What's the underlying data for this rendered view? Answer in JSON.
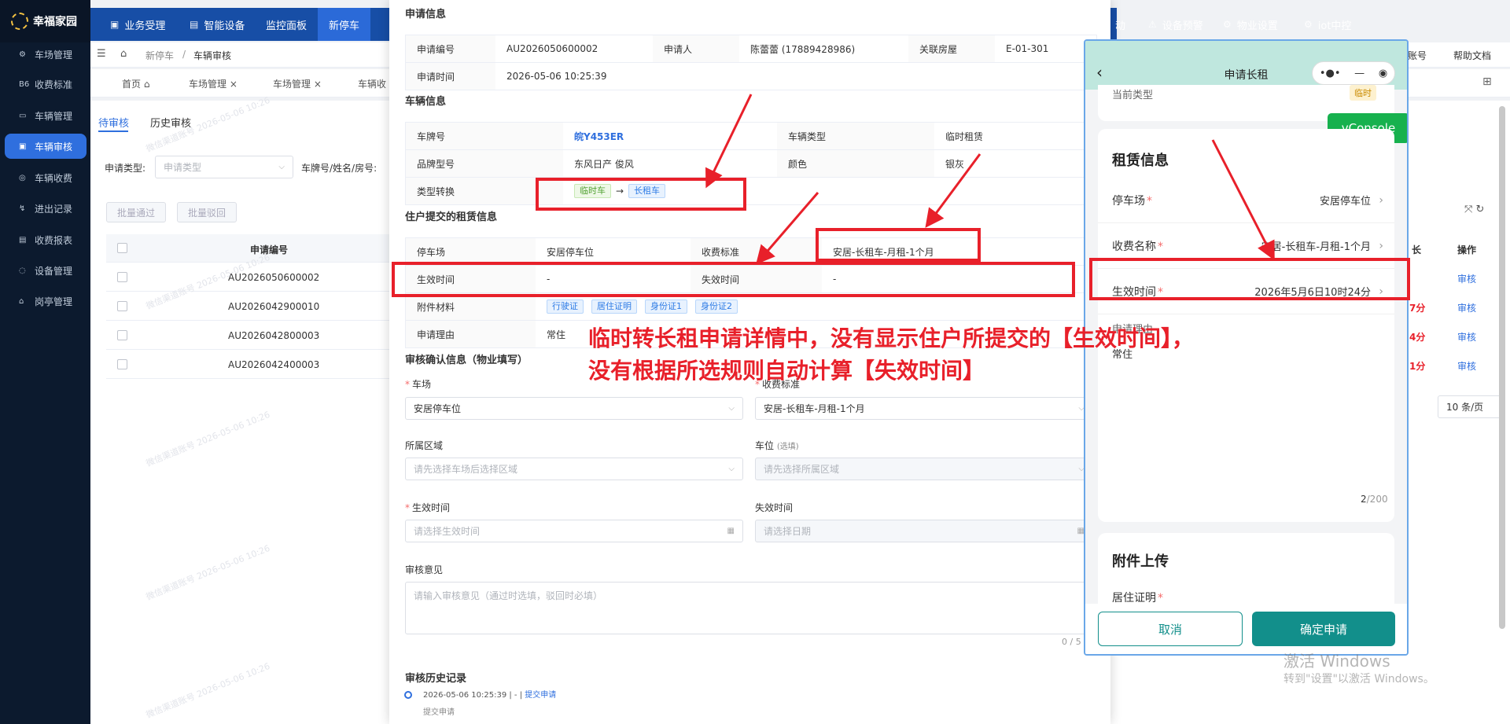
{
  "app": {
    "name": "幸福家园"
  },
  "sidebar": {
    "items": [
      {
        "label": "车场管理",
        "icon": "gear-icon"
      },
      {
        "label": "收费标准",
        "icon": "tag-icon"
      },
      {
        "label": "车辆管理",
        "icon": "car-icon"
      },
      {
        "label": "车辆审核",
        "icon": "audit-icon"
      },
      {
        "label": "车辆收费",
        "icon": "coin-icon"
      },
      {
        "label": "进出记录",
        "icon": "record-icon"
      },
      {
        "label": "收费报表",
        "icon": "report-icon"
      },
      {
        "label": "设备管理",
        "icon": "device-icon"
      },
      {
        "label": "岗亭管理",
        "icon": "booth-icon"
      }
    ]
  },
  "topnav": {
    "items": [
      "业务受理",
      "智能设备",
      "监控面板",
      "新停车"
    ],
    "right_items": [
      "动",
      "设备预警",
      "物业设置",
      "iot中控"
    ]
  },
  "breadcrumb": {
    "items": [
      "新停车",
      "车辆审核"
    ]
  },
  "header_right": {
    "help": "帮助文档",
    "account": "账号"
  },
  "page_tabs": [
    {
      "label": "首页"
    },
    {
      "label": "车场管理"
    },
    {
      "label": "车场管理"
    },
    {
      "label": "车辆收"
    }
  ],
  "review_tabs": {
    "pending": "待审核",
    "history": "历史审核"
  },
  "filters": {
    "type_label": "申请类型:",
    "type_placeholder": "申请类型",
    "plate_label": "车牌号/姓名/房号:"
  },
  "batch": {
    "approve": "批量通过",
    "reject": "批量驳回"
  },
  "list": {
    "columns": {
      "id": "申请编号",
      "op": "操作",
      "right_col": "长"
    },
    "rows": [
      {
        "id": "AU2026050600002",
        "right": "",
        "op": "审核"
      },
      {
        "id": "AU2026042900010",
        "right": "7分",
        "op": "审核"
      },
      {
        "id": "AU2026042800003",
        "right": "4分",
        "op": "审核"
      },
      {
        "id": "AU2026042400003",
        "right": "1分",
        "op": "审核"
      }
    ],
    "page_size": "10 条/页"
  },
  "dialog": {
    "apply_info": {
      "title": "申请信息",
      "no_label": "申请编号",
      "no_value": "AU2026050600002",
      "applicant_label": "申请人",
      "applicant_value": "陈蕾蕾 (17889428986)",
      "house_label": "关联房屋",
      "house_value": "E-01-301",
      "time_label": "申请时间",
      "time_value": "2026-05-06 10:25:39"
    },
    "vehicle_info": {
      "title": "车辆信息",
      "plate_label": "车牌号",
      "plate_value": "皖Y453ER",
      "type_label": "车辆类型",
      "type_value": "临时租赁",
      "brand_label": "品牌型号",
      "brand_value": "东风日产 俊风",
      "color_label": "颜色",
      "color_value": "银灰",
      "convert_label": "类型转换",
      "convert_from": "临时车",
      "convert_arrow": "→",
      "convert_to": "长租车"
    },
    "rent_info": {
      "title": "住户提交的租赁信息",
      "lot_label": "停车场",
      "lot_value": "安居停车位",
      "std_label": "收费标准",
      "std_value": "安居-长租车-月租-1个月",
      "start_label": "生效时间",
      "start_value": "-",
      "end_label": "失效时间",
      "end_value": "-",
      "attach_label": "附件材料",
      "attachments": [
        "行驶证",
        "居住证明",
        "身份证1",
        "身份证2"
      ],
      "reason_label": "申请理由",
      "reason_value": "常住"
    },
    "confirm": {
      "title": "审核确认信息（物业填写）",
      "lot_label": "车场",
      "lot_value": "安居停车位",
      "std_label": "收费标准",
      "std_value": "安居-长租车-月租-1个月",
      "area_label": "所属区域",
      "area_placeholder": "请先选择车场后选择区域",
      "space_label": "车位",
      "space_hint": "(选填)",
      "space_placeholder": "请先选择所属区域",
      "start_label": "生效时间",
      "start_placeholder": "请选择生效时间",
      "end_label": "失效时间",
      "end_placeholder": "请选择日期",
      "opinion_label": "审核意见",
      "opinion_placeholder": "请输入审核意见（通过时选填，驳回时必填）",
      "counter": "0 / 5"
    },
    "history": {
      "title": "审核历史记录",
      "entry_time": "2026-05-06 10:25:39 | - | ",
      "entry_action": "提交申请",
      "entry_desc": "提交申请"
    }
  },
  "phone": {
    "title": "申请长租",
    "prev_label": "当前类型",
    "prev_tag": "临时",
    "vconsole": "vConsole",
    "rent_title": "租赁信息",
    "lot_label": "停车场",
    "lot_value": "安居停车位",
    "fee_label": "收费名称",
    "fee_value": "安居-长租车-月租-1个月",
    "start_label": "生效时间",
    "start_value": "2026年5月6日10时24分",
    "reason_label": "申请理由",
    "reason_value": "常住",
    "counter_cur": "2",
    "counter_max": "/200",
    "attach_title": "附件上传",
    "residence_label": "居住证明",
    "cancel": "取消",
    "submit": "确定申请"
  },
  "annotation": {
    "line1": "临时转长租申请详情中，没有显示住户所提交的【生效时间】，",
    "line2": "没有根据所选规则自动计算【失效时间】"
  },
  "windows": {
    "line1": "激活 Windows",
    "line2": "转到\"设置\"以激活 Windows。"
  },
  "watermark": "微信渠道账号 2026-05-06 10:26",
  "colors": {
    "sidebar": "#0c1a2e",
    "topnav": "#174ea6",
    "active": "#2f6fde",
    "red": "#e8202a",
    "teal": "#128f8b"
  }
}
